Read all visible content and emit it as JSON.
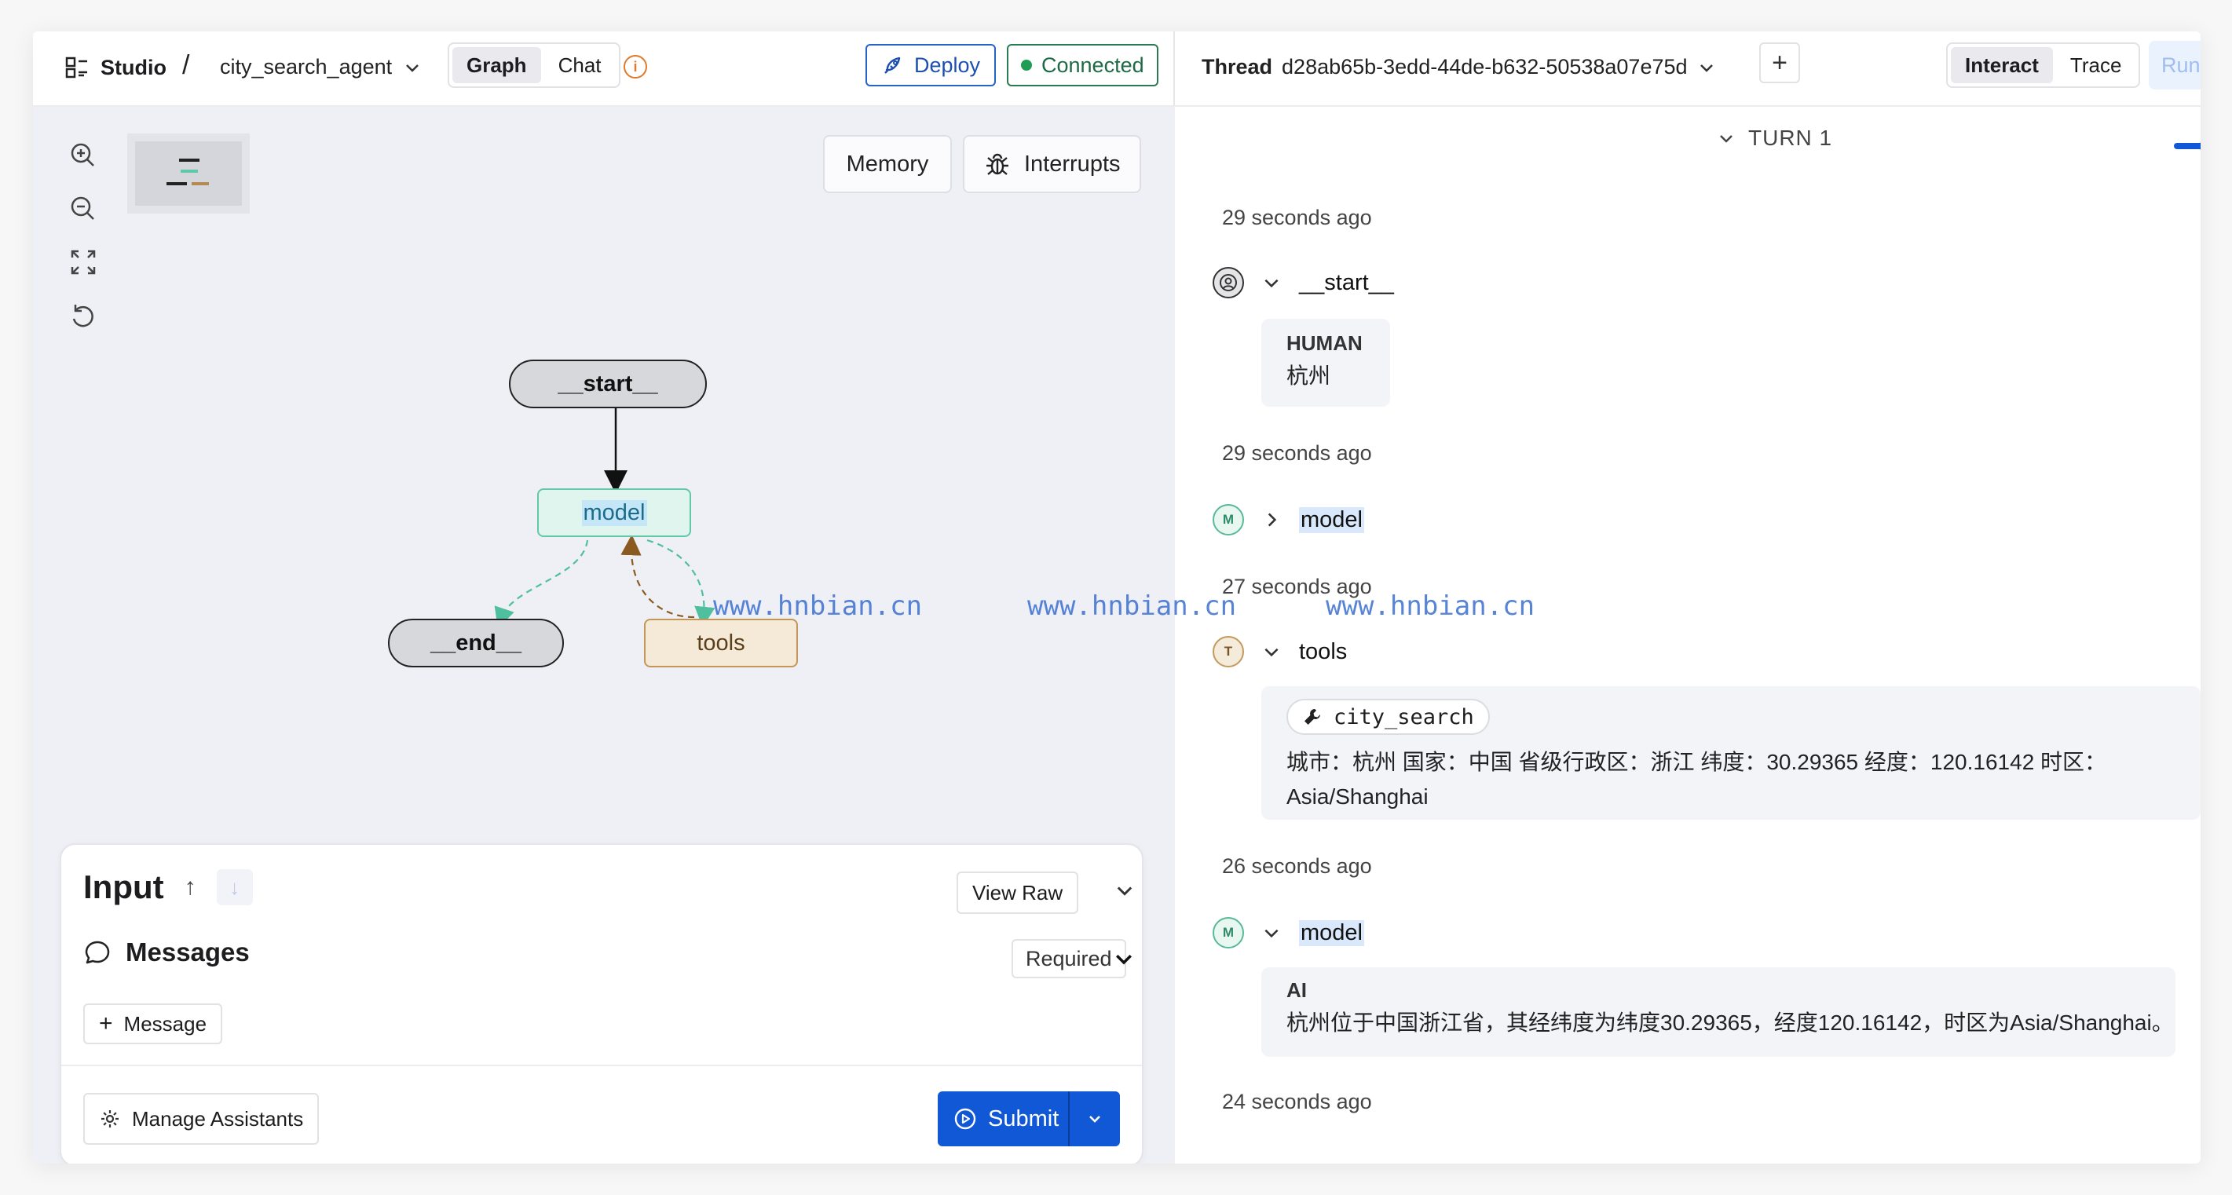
{
  "header": {
    "studio_label": "Studio",
    "separator": "/",
    "agent_name": "city_search_agent",
    "tabs": [
      "Graph",
      "Chat"
    ],
    "info_glyph": "i",
    "deploy_label": "Deploy",
    "connected_label": "Connected"
  },
  "canvas": {
    "memory_label": "Memory",
    "interrupts_label": "Interrupts",
    "nodes": {
      "start": "__start__",
      "model": "model",
      "end": "__end__",
      "tools": "tools"
    }
  },
  "input_panel": {
    "title": "Input",
    "view_raw_label": "View Raw",
    "messages_label": "Messages",
    "required_label": "Required",
    "add_message_label": "Message",
    "manage_assistants_label": "Manage Assistants",
    "submit_label": "Submit"
  },
  "thread_header": {
    "label": "Thread",
    "id": "d28ab65b-3edd-44de-b632-50538a07e75d",
    "modes": [
      "Interact",
      "Trace"
    ],
    "run_label": "Run exp"
  },
  "turn": {
    "label": "TURN 1"
  },
  "timeline": [
    {
      "time": "29 seconds ago",
      "node": "__start__",
      "avatar": "",
      "role": "HUMAN",
      "content": "杭州"
    },
    {
      "time": "29 seconds ago",
      "node": "model",
      "avatar": "M"
    },
    {
      "time": "27 seconds ago",
      "node": "tools",
      "avatar": "T",
      "tool_name": "city_search",
      "content_line1": "城市：杭州 国家：中国 省级行政区：浙江 纬度：30.29365 经度：120.16142 时区：",
      "content_line2": "Asia/Shanghai"
    },
    {
      "time": "26 seconds ago",
      "node": "model",
      "avatar": "M",
      "role": "AI",
      "content": "杭州位于中国浙江省，其经纬度为纬度30.29365，经度120.16142，时区为Asia/Shanghai。"
    },
    {
      "time": "24 seconds ago"
    }
  ],
  "watermarks": [
    "www.hnbian.cn",
    "www.hnbian.cn",
    "www.hnbian.cn"
  ],
  "colors": {
    "accent": "#1058d6",
    "connected": "#1f9d55",
    "model_node": "#63c7a8",
    "tools_node": "#c4965a"
  }
}
